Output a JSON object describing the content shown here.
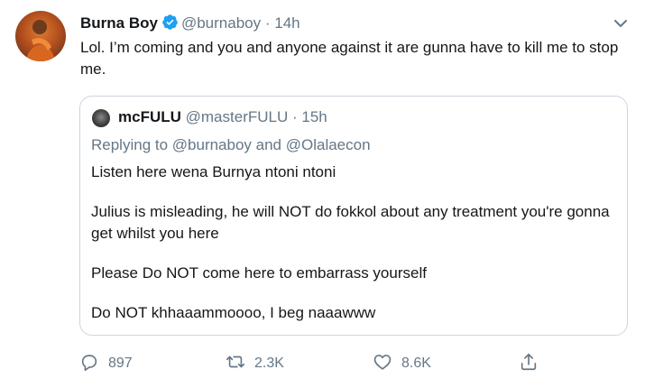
{
  "tweet": {
    "author_name": "Burna Boy",
    "author_handle": "@burnaboy",
    "separator": "·",
    "time": "14h",
    "text": "Lol. I’m coming and you and anyone against it are gunna have to kill me to stop me."
  },
  "quote": {
    "author_name": "mcFULU",
    "author_handle": "@masterFULU",
    "separator": "·",
    "time": "15h",
    "replying_to": "Replying to @burnaboy and @Olalaecon",
    "lines": [
      "Listen here wena Burnya ntoni ntoni",
      "Julius is misleading, he will NOT do fokkol about any treatment you're gonna get whilst you here",
      "Please Do NOT come here to embarrass yourself",
      "Do NOT khhaaammoooo, I beg naaawww"
    ]
  },
  "actions": {
    "replies": "897",
    "retweets": "2.3K",
    "likes": "8.6K"
  },
  "colors": {
    "verified": "#1da1f2",
    "muted": "#657786",
    "border": "#ccd6dd"
  },
  "icons": [
    "verified-icon",
    "chevron-down-icon",
    "reply-icon",
    "retweet-icon",
    "like-icon",
    "share-icon"
  ]
}
